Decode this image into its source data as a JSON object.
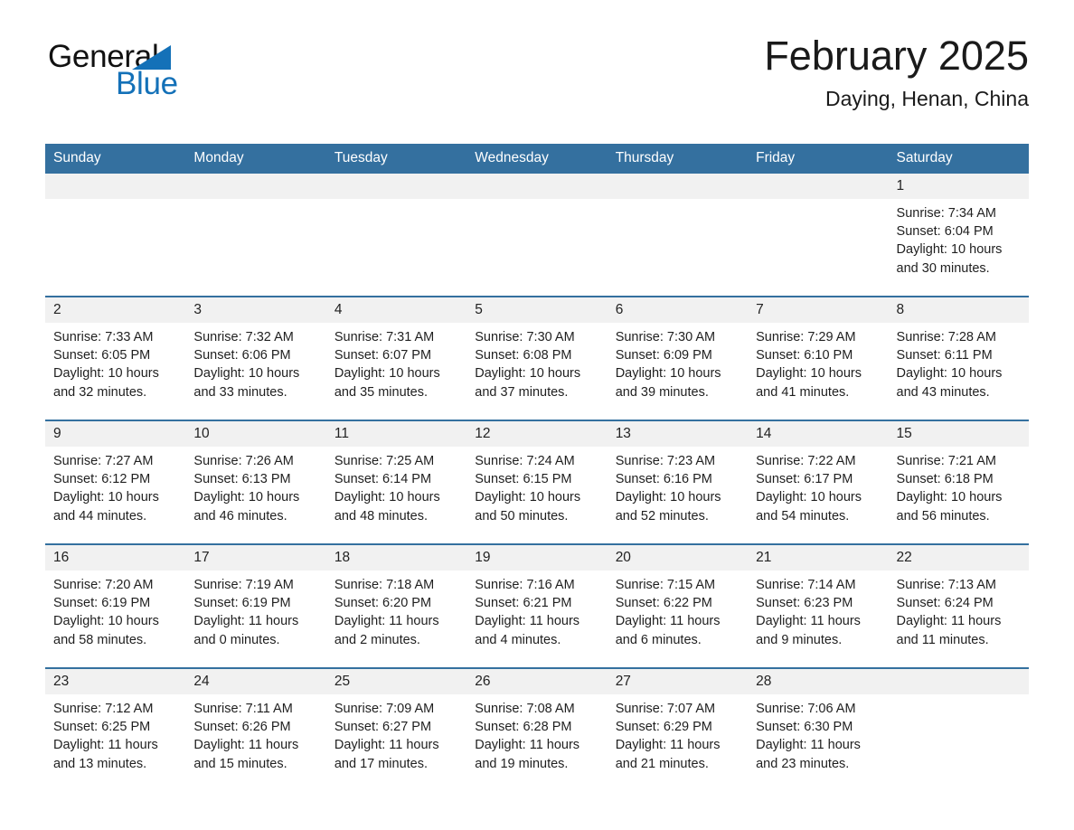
{
  "brand": {
    "name_top": "General",
    "name_bottom": "Blue",
    "accent_color": "#1471b8"
  },
  "header": {
    "month_title": "February 2025",
    "location": "Daying, Henan, China"
  },
  "theme": {
    "header_bar": "#34709f",
    "day_band": "#f1f1f1",
    "text": "#1f1f1f"
  },
  "weekday_headers": [
    "Sunday",
    "Monday",
    "Tuesday",
    "Wednesday",
    "Thursday",
    "Friday",
    "Saturday"
  ],
  "weeks": [
    [
      {
        "day": "",
        "blank": true
      },
      {
        "day": "",
        "blank": true
      },
      {
        "day": "",
        "blank": true
      },
      {
        "day": "",
        "blank": true
      },
      {
        "day": "",
        "blank": true
      },
      {
        "day": "",
        "blank": true
      },
      {
        "day": "1",
        "sunrise": "Sunrise: 7:34 AM",
        "sunset": "Sunset: 6:04 PM",
        "daylight": "Daylight: 10 hours and 30 minutes."
      }
    ],
    [
      {
        "day": "2",
        "sunrise": "Sunrise: 7:33 AM",
        "sunset": "Sunset: 6:05 PM",
        "daylight": "Daylight: 10 hours and 32 minutes."
      },
      {
        "day": "3",
        "sunrise": "Sunrise: 7:32 AM",
        "sunset": "Sunset: 6:06 PM",
        "daylight": "Daylight: 10 hours and 33 minutes."
      },
      {
        "day": "4",
        "sunrise": "Sunrise: 7:31 AM",
        "sunset": "Sunset: 6:07 PM",
        "daylight": "Daylight: 10 hours and 35 minutes."
      },
      {
        "day": "5",
        "sunrise": "Sunrise: 7:30 AM",
        "sunset": "Sunset: 6:08 PM",
        "daylight": "Daylight: 10 hours and 37 minutes."
      },
      {
        "day": "6",
        "sunrise": "Sunrise: 7:30 AM",
        "sunset": "Sunset: 6:09 PM",
        "daylight": "Daylight: 10 hours and 39 minutes."
      },
      {
        "day": "7",
        "sunrise": "Sunrise: 7:29 AM",
        "sunset": "Sunset: 6:10 PM",
        "daylight": "Daylight: 10 hours and 41 minutes."
      },
      {
        "day": "8",
        "sunrise": "Sunrise: 7:28 AM",
        "sunset": "Sunset: 6:11 PM",
        "daylight": "Daylight: 10 hours and 43 minutes."
      }
    ],
    [
      {
        "day": "9",
        "sunrise": "Sunrise: 7:27 AM",
        "sunset": "Sunset: 6:12 PM",
        "daylight": "Daylight: 10 hours and 44 minutes."
      },
      {
        "day": "10",
        "sunrise": "Sunrise: 7:26 AM",
        "sunset": "Sunset: 6:13 PM",
        "daylight": "Daylight: 10 hours and 46 minutes."
      },
      {
        "day": "11",
        "sunrise": "Sunrise: 7:25 AM",
        "sunset": "Sunset: 6:14 PM",
        "daylight": "Daylight: 10 hours and 48 minutes."
      },
      {
        "day": "12",
        "sunrise": "Sunrise: 7:24 AM",
        "sunset": "Sunset: 6:15 PM",
        "daylight": "Daylight: 10 hours and 50 minutes."
      },
      {
        "day": "13",
        "sunrise": "Sunrise: 7:23 AM",
        "sunset": "Sunset: 6:16 PM",
        "daylight": "Daylight: 10 hours and 52 minutes."
      },
      {
        "day": "14",
        "sunrise": "Sunrise: 7:22 AM",
        "sunset": "Sunset: 6:17 PM",
        "daylight": "Daylight: 10 hours and 54 minutes."
      },
      {
        "day": "15",
        "sunrise": "Sunrise: 7:21 AM",
        "sunset": "Sunset: 6:18 PM",
        "daylight": "Daylight: 10 hours and 56 minutes."
      }
    ],
    [
      {
        "day": "16",
        "sunrise": "Sunrise: 7:20 AM",
        "sunset": "Sunset: 6:19 PM",
        "daylight": "Daylight: 10 hours and 58 minutes."
      },
      {
        "day": "17",
        "sunrise": "Sunrise: 7:19 AM",
        "sunset": "Sunset: 6:19 PM",
        "daylight": "Daylight: 11 hours and 0 minutes."
      },
      {
        "day": "18",
        "sunrise": "Sunrise: 7:18 AM",
        "sunset": "Sunset: 6:20 PM",
        "daylight": "Daylight: 11 hours and 2 minutes."
      },
      {
        "day": "19",
        "sunrise": "Sunrise: 7:16 AM",
        "sunset": "Sunset: 6:21 PM",
        "daylight": "Daylight: 11 hours and 4 minutes."
      },
      {
        "day": "20",
        "sunrise": "Sunrise: 7:15 AM",
        "sunset": "Sunset: 6:22 PM",
        "daylight": "Daylight: 11 hours and 6 minutes."
      },
      {
        "day": "21",
        "sunrise": "Sunrise: 7:14 AM",
        "sunset": "Sunset: 6:23 PM",
        "daylight": "Daylight: 11 hours and 9 minutes."
      },
      {
        "day": "22",
        "sunrise": "Sunrise: 7:13 AM",
        "sunset": "Sunset: 6:24 PM",
        "daylight": "Daylight: 11 hours and 11 minutes."
      }
    ],
    [
      {
        "day": "23",
        "sunrise": "Sunrise: 7:12 AM",
        "sunset": "Sunset: 6:25 PM",
        "daylight": "Daylight: 11 hours and 13 minutes."
      },
      {
        "day": "24",
        "sunrise": "Sunrise: 7:11 AM",
        "sunset": "Sunset: 6:26 PM",
        "daylight": "Daylight: 11 hours and 15 minutes."
      },
      {
        "day": "25",
        "sunrise": "Sunrise: 7:09 AM",
        "sunset": "Sunset: 6:27 PM",
        "daylight": "Daylight: 11 hours and 17 minutes."
      },
      {
        "day": "26",
        "sunrise": "Sunrise: 7:08 AM",
        "sunset": "Sunset: 6:28 PM",
        "daylight": "Daylight: 11 hours and 19 minutes."
      },
      {
        "day": "27",
        "sunrise": "Sunrise: 7:07 AM",
        "sunset": "Sunset: 6:29 PM",
        "daylight": "Daylight: 11 hours and 21 minutes."
      },
      {
        "day": "28",
        "sunrise": "Sunrise: 7:06 AM",
        "sunset": "Sunset: 6:30 PM",
        "daylight": "Daylight: 11 hours and 23 minutes."
      },
      {
        "day": "",
        "blank": true
      }
    ]
  ]
}
